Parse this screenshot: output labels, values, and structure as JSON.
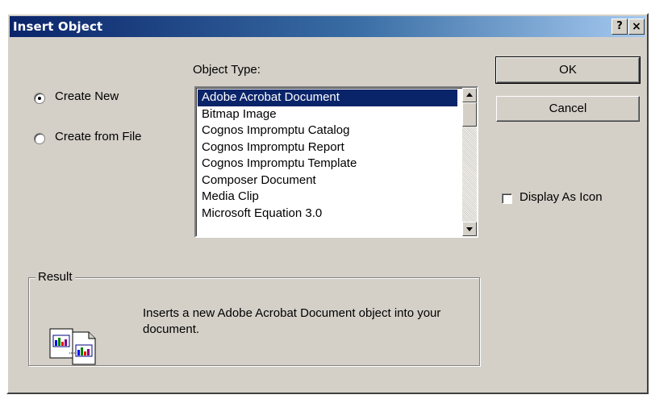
{
  "window": {
    "title": "Insert Object",
    "help_button": "?",
    "close_button": "×"
  },
  "options": {
    "create_new": {
      "label": "Create New",
      "selected": true
    },
    "create_from_file": {
      "label": "Create from File",
      "selected": false
    }
  },
  "object_type": {
    "label": "Object Type:",
    "items": [
      "Adobe Acrobat Document",
      "Bitmap Image",
      "Cognos Impromptu Catalog",
      "Cognos Impromptu Report",
      "Cognos Impromptu Template",
      "Composer Document",
      "Media Clip",
      "Microsoft Equation 3.0"
    ],
    "selected_index": 0
  },
  "buttons": {
    "ok": "OK",
    "cancel": "Cancel"
  },
  "display_as_icon": {
    "label": "Display As Icon",
    "checked": false
  },
  "result": {
    "label": "Result",
    "text": "Inserts a new Adobe Acrobat Document object into your document.",
    "icon": "insert-object-icon"
  },
  "colors": {
    "titlebar_start": "#0a246a",
    "titlebar_end": "#a6caf0",
    "dialog_face": "#d4d0c8",
    "selection": "#0a246a"
  }
}
